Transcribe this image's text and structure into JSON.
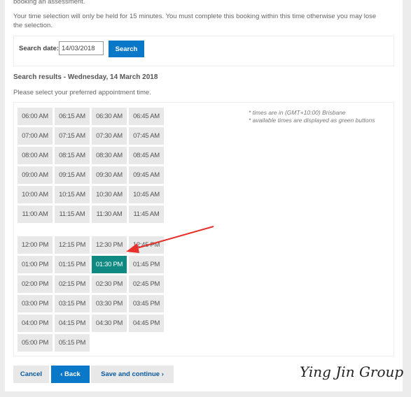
{
  "intro_text": "booking an assessment.",
  "hold_text": "Your time selection will only be held for 15 minutes. You must complete this booking within this time otherwise you may lose the selection.",
  "search": {
    "label": "Search date:",
    "value": "14/03/2018",
    "button": "Search"
  },
  "results": {
    "title": "Search results - Wednesday, 14 March 2018",
    "subtitle": "Please select your preferred appointment time.",
    "notes": [
      "* times are in (GMT+10:00) Brisbane",
      "* available times are displayed as green buttons"
    ],
    "selected": "01:30 PM",
    "selected_color": "#0f8a82",
    "am_slots": [
      "06:00 AM",
      "06:15 AM",
      "06:30 AM",
      "06:45 AM",
      "07:00 AM",
      "07:15 AM",
      "07:30 AM",
      "07:45 AM",
      "08:00 AM",
      "08:15 AM",
      "08:30 AM",
      "08:45 AM",
      "09:00 AM",
      "09:15 AM",
      "09:30 AM",
      "09:45 AM",
      "10:00 AM",
      "10:15 AM",
      "10:30 AM",
      "10:45 AM",
      "11:00 AM",
      "11:15 AM",
      "11:30 AM",
      "11:45 AM"
    ],
    "pm_slots": [
      "12:00 PM",
      "12:15 PM",
      "12:30 PM",
      "12:45 PM",
      "01:00 PM",
      "01:15 PM",
      "01:30 PM",
      "01:45 PM",
      "02:00 PM",
      "02:15 PM",
      "02:30 PM",
      "02:45 PM",
      "03:00 PM",
      "03:15 PM",
      "03:30 PM",
      "03:45 PM",
      "04:00 PM",
      "04:15 PM",
      "04:30 PM",
      "04:45 PM",
      "05:00 PM",
      "05:15 PM"
    ]
  },
  "actions": {
    "cancel": "Cancel",
    "back": "Back",
    "save": "Save and continue"
  },
  "watermark": "Ying Jin Group",
  "annotation_color": "#e8302a"
}
